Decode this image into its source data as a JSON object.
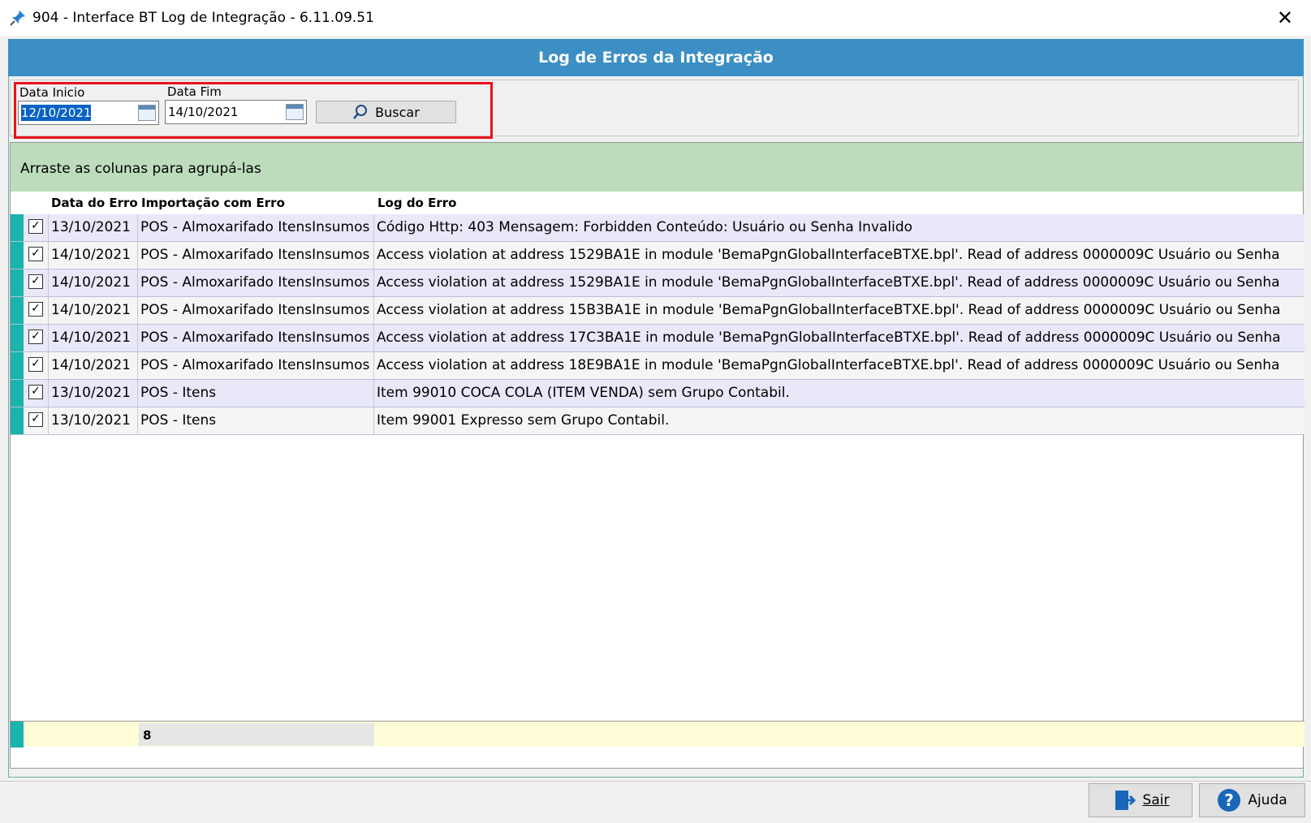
{
  "window": {
    "title": "904 - Interface BT Log de Integração - 6.11.09.51",
    "close_glyph": "✕"
  },
  "header": {
    "title": "Log de Erros da Integração"
  },
  "filter": {
    "start_label": "Data Inicio",
    "start_value": "12/10/2021",
    "end_label": "Data Fim",
    "end_value": "14/10/2021",
    "search_label": "Buscar"
  },
  "grid": {
    "group_hint": "Arraste as colunas para agrupá-las",
    "columns": [
      "Data do Erro",
      "Importação com Erro",
      "Log do Erro"
    ],
    "rows": [
      {
        "date": "13/10/2021",
        "import": "POS - Almoxarifado ItensInsumos",
        "log": "Código Http: 403 Mensagem: Forbidden Conteúdo:  Usuário ou Senha Invalido"
      },
      {
        "date": "14/10/2021",
        "import": "POS - Almoxarifado ItensInsumos",
        "log": "Access violation at address 1529BA1E in module 'BemaPgnGlobalInterfaceBTXE.bpl'. Read of address 0000009C Usuário ou Senha"
      },
      {
        "date": "14/10/2021",
        "import": "POS - Almoxarifado ItensInsumos",
        "log": "Access violation at address 1529BA1E in module 'BemaPgnGlobalInterfaceBTXE.bpl'. Read of address 0000009C Usuário ou Senha"
      },
      {
        "date": "14/10/2021",
        "import": "POS - Almoxarifado ItensInsumos",
        "log": "Access violation at address 15B3BA1E in module 'BemaPgnGlobalInterfaceBTXE.bpl'. Read of address 0000009C Usuário ou Senha"
      },
      {
        "date": "14/10/2021",
        "import": "POS - Almoxarifado ItensInsumos",
        "log": "Access violation at address 17C3BA1E in module 'BemaPgnGlobalInterfaceBTXE.bpl'. Read of address 0000009C Usuário ou Senha"
      },
      {
        "date": "14/10/2021",
        "import": "POS - Almoxarifado ItensInsumos",
        "log": "Access violation at address 18E9BA1E in module 'BemaPgnGlobalInterfaceBTXE.bpl'. Read of address 0000009C Usuário ou Senha"
      },
      {
        "date": "13/10/2021",
        "import": "POS - Itens",
        "log": "Item 99010  COCA COLA (ITEM VENDA) sem Grupo Contabil."
      },
      {
        "date": "13/10/2021",
        "import": "POS - Itens",
        "log": "Item 99001  Expresso sem Grupo Contabil."
      }
    ],
    "count": "8"
  },
  "buttons": {
    "exit": "Sair",
    "help": "Ajuda"
  }
}
